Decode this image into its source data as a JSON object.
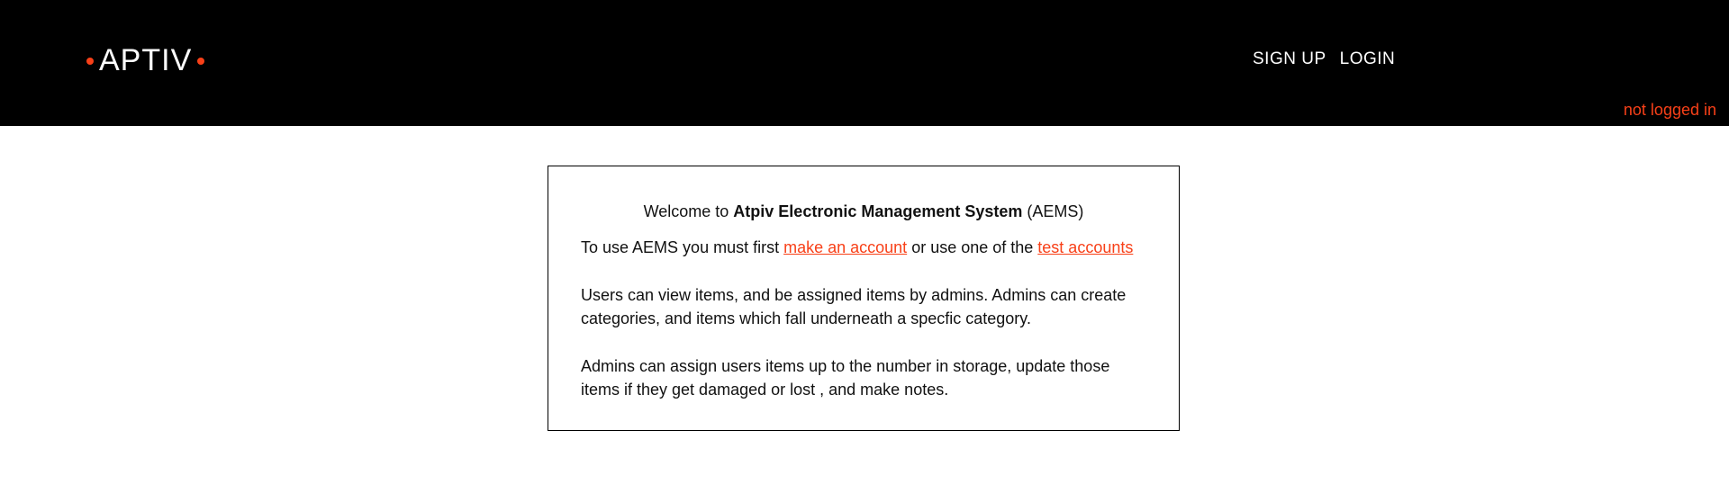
{
  "header": {
    "logo_text": "APTIV",
    "nav": {
      "signup_label": "SIGN UP",
      "login_label": "LOGIN"
    },
    "status_text": "not logged in"
  },
  "welcome": {
    "prefix": "Welcome to ",
    "system_name": "Atpiv Electronic Management System",
    "suffix": " (AEMS)"
  },
  "intro": {
    "text_before": "To use AEMS you must first ",
    "make_account_link": "make an account",
    "text_middle": " or use one of the ",
    "test_accounts_link": "test accounts"
  },
  "paragraphs": {
    "users": "Users can view items, and be assigned items by admins. Admins can create categories, and items which fall underneath a specfic category.",
    "admins": "Admins can assign users items up to the number in storage, update those items if they get damaged or lost , and make notes."
  },
  "colors": {
    "accent": "#f84018",
    "header_bg": "#000000"
  }
}
